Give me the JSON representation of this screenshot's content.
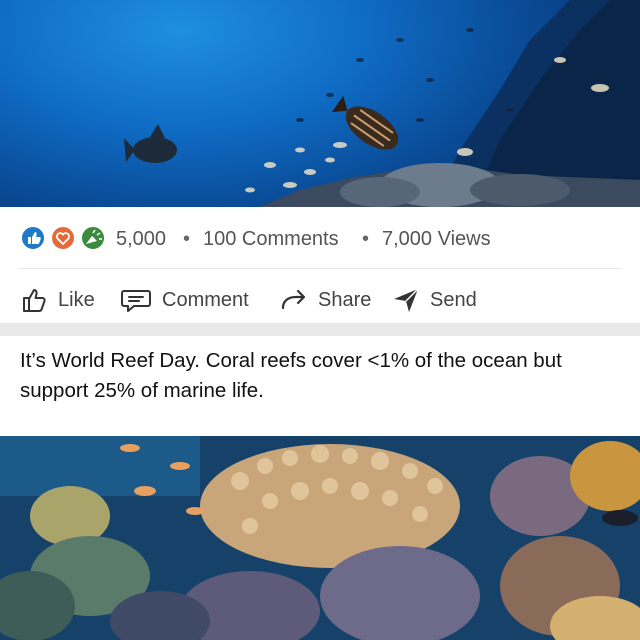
{
  "post": {
    "top_image_alt_icon": "underwater-reef-photo",
    "bottom_image_alt_icon": "coral-reef-photo",
    "reactions": {
      "icons": [
        "thumbs-up-icon",
        "heart-icon",
        "celebrate-icon"
      ],
      "count": "5,000",
      "comments": "100 Comments",
      "views": "7,000 Views",
      "separator": "•"
    },
    "actions": {
      "like": "Like",
      "comment": "Comment",
      "share": "Share",
      "send": "Send"
    },
    "caption": "It’s World Reef Day.  Coral reefs cover <1% of the ocean but support 25% of marine life."
  },
  "colors": {
    "like_blue": "#1f79c7",
    "heart_orange": "#e56a3b",
    "celebrate_green": "#3c8a3e",
    "text_gray": "#555555"
  }
}
